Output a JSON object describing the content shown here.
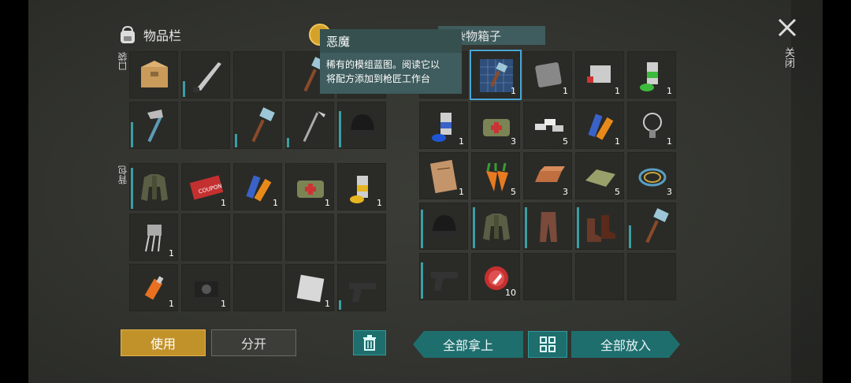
{
  "inventory": {
    "title": "物品栏",
    "pocket_label": "口袋",
    "backpack_label": "背包",
    "pocket_slots": [
      {
        "item": "cardboard-box-icon",
        "qty": "",
        "bar": 0
      },
      {
        "item": "machete-icon",
        "qty": "",
        "bar": 0.35
      },
      {
        "item": "empty",
        "qty": "",
        "bar": 0
      },
      {
        "item": "sledgehammer-icon",
        "qty": "",
        "bar": 0
      },
      {
        "item": "empty",
        "qty": "",
        "bar": 0
      },
      {
        "item": "hatchet-icon",
        "qty": "",
        "bar": 0.55
      },
      {
        "item": "empty",
        "qty": "",
        "bar": 0
      },
      {
        "item": "sledgehammer-icon",
        "qty": "",
        "bar": 0.3
      },
      {
        "item": "hoe-icon",
        "qty": "",
        "bar": 0.2
      },
      {
        "item": "beanie-icon",
        "qty": "",
        "bar": 0.8
      }
    ],
    "backpack_slots": [
      {
        "item": "jacket-icon",
        "qty": "",
        "bar": 0.9
      },
      {
        "item": "coupon-icon",
        "qty": "1",
        "bar": 0
      },
      {
        "item": "batteries-icon",
        "qty": "1",
        "bar": 0
      },
      {
        "item": "medkit-bag-icon",
        "qty": "1",
        "bar": 0
      },
      {
        "item": "spray-can-yellow-icon",
        "qty": "1",
        "bar": 0
      },
      {
        "item": "transistor-icon",
        "qty": "1",
        "bar": 0
      },
      {
        "item": "empty",
        "qty": "",
        "bar": 0
      },
      {
        "item": "empty",
        "qty": "",
        "bar": 0
      },
      {
        "item": "empty",
        "qty": "",
        "bar": 0
      },
      {
        "item": "empty",
        "qty": "",
        "bar": 0
      },
      {
        "item": "usb-stick-icon",
        "qty": "1",
        "bar": 0
      },
      {
        "item": "camera-icon",
        "qty": "1",
        "bar": 0
      },
      {
        "item": "empty",
        "qty": "",
        "bar": 0
      },
      {
        "item": "metal-sheet-icon",
        "qty": "1",
        "bar": 0
      },
      {
        "item": "pistol-icon",
        "qty": "",
        "bar": 0.2
      }
    ]
  },
  "buttons": {
    "use": "使用",
    "split": "分开",
    "take_all": "全部拿上",
    "put_all": "全部放入"
  },
  "chest": {
    "title": "杂物箱子",
    "slots": [
      {
        "item": "empty",
        "qty": "",
        "bar": 0
      },
      {
        "item": "blueprint-icon",
        "qty": "1",
        "bar": 0
      },
      {
        "item": "metal-plate-icon",
        "qty": "1",
        "bar": 0
      },
      {
        "item": "engine-part-icon",
        "qty": "1",
        "bar": 0
      },
      {
        "item": "spray-can-green-icon",
        "qty": "1",
        "bar": 0
      },
      {
        "item": "spray-can-blue-icon",
        "qty": "1",
        "bar": 0
      },
      {
        "item": "medkit-bag-icon",
        "qty": "3",
        "bar": 0
      },
      {
        "item": "metal-bars-icon",
        "qty": "5",
        "bar": 0
      },
      {
        "item": "batteries-icon",
        "qty": "1",
        "bar": 0
      },
      {
        "item": "light-bulb-icon",
        "qty": "1",
        "bar": 0
      },
      {
        "item": "notebook-icon",
        "qty": "1",
        "bar": 0
      },
      {
        "item": "carrots-icon",
        "qty": "5",
        "bar": 0
      },
      {
        "item": "copper-ingot-icon",
        "qty": "3",
        "bar": 0
      },
      {
        "item": "cloth-icon",
        "qty": "5",
        "bar": 0
      },
      {
        "item": "wire-coil-icon",
        "qty": "3",
        "bar": 0
      },
      {
        "item": "beanie-icon",
        "qty": "",
        "bar": 0.85
      },
      {
        "item": "jacket-icon",
        "qty": "",
        "bar": 0.9
      },
      {
        "item": "pants-icon",
        "qty": "",
        "bar": 0.9
      },
      {
        "item": "boots-icon",
        "qty": "",
        "bar": 0.9
      },
      {
        "item": "sledgehammer-icon",
        "qty": "",
        "bar": 0.5
      },
      {
        "item": "pistol-icon",
        "qty": "",
        "bar": 0.8
      },
      {
        "item": "bottle-cap-icon",
        "qty": "10",
        "bar": 0
      },
      {
        "item": "empty",
        "qty": "",
        "bar": 0
      },
      {
        "item": "empty",
        "qty": "",
        "bar": 0
      },
      {
        "item": "empty",
        "qty": "",
        "bar": 0
      }
    ]
  },
  "tooltip": {
    "title": "恶魔",
    "description_line1": "稀有的模组蓝图。阅读它以",
    "description_line2": "将配方添加到枪匠工作台"
  },
  "close_label": "关闭",
  "colors": {
    "accent": "#1f6e6e",
    "gold": "#c2922a",
    "durability": "#3c9ea3"
  }
}
